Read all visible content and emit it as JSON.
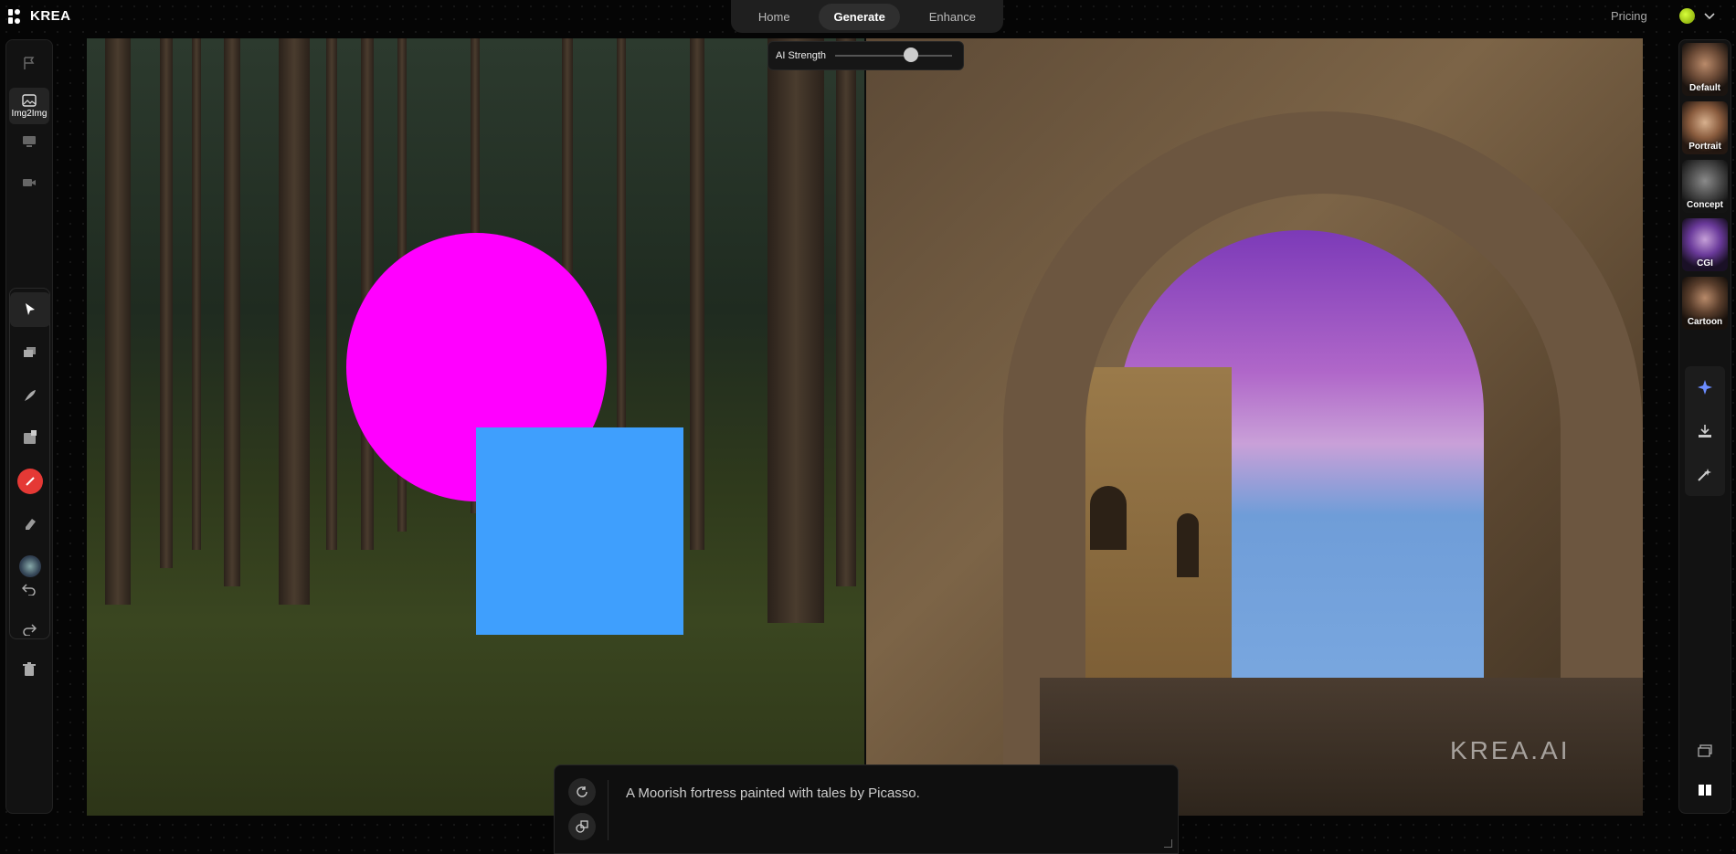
{
  "app": {
    "name": "KREA",
    "watermark": "KREA.AI"
  },
  "nav": {
    "tabs": [
      "Home",
      "Generate",
      "Enhance"
    ],
    "active": "Generate",
    "pricing": "Pricing"
  },
  "left_tools": {
    "img2img_label": "Img2Img"
  },
  "strength": {
    "label": "AI Strength",
    "value": 0.65
  },
  "styles": [
    "Default",
    "Portrait",
    "Concept",
    "CGI",
    "Cartoon"
  ],
  "prompt": {
    "text": "A Moorish fortress painted with tales by Picasso."
  },
  "colors": {
    "circle": "#ff00ff",
    "square": "#3f9ffd",
    "record": "#e53935"
  }
}
